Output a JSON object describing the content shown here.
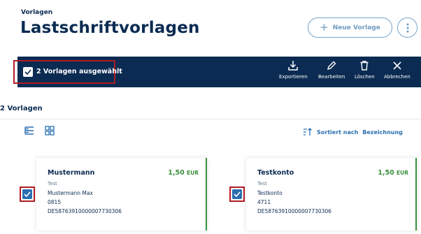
{
  "header": {
    "eyebrow": "Vorlagen",
    "title": "Lastschriftvorlagen",
    "new_button_label": "Neue Vorlage"
  },
  "selection_bar": {
    "label": "2 Vorlagen ausgewählt",
    "actions": [
      {
        "icon": "download-icon",
        "label": "Exportieren"
      },
      {
        "icon": "pencil-icon",
        "label": "Bearbeiten"
      },
      {
        "icon": "trash-icon",
        "label": "Löschen"
      },
      {
        "icon": "close-icon",
        "label": "Abbrechen"
      }
    ]
  },
  "list": {
    "count_label": "2 Vorlagen",
    "sort_prefix": "Sortiert nach",
    "sort_field": "Bezeichnung"
  },
  "cards": [
    {
      "name": "Mustermann",
      "amount": "1,50",
      "currency": "EUR",
      "line1": "Test",
      "line2": "Mustermann Max",
      "line3": "0815",
      "line4": "DE58763910000007730306",
      "selected": true
    },
    {
      "name": "Testkonto",
      "amount": "1,50",
      "currency": "EUR",
      "line1": "Test",
      "line2": "Testkonto",
      "line3": "4711",
      "line4": "DE58763910000007730306",
      "selected": true
    }
  ],
  "colors": {
    "brand_navy": "#0b2b52",
    "accent_blue": "#2a6fb0",
    "amount_green": "#3a8f3d",
    "highlight_red": "#b01c24"
  }
}
